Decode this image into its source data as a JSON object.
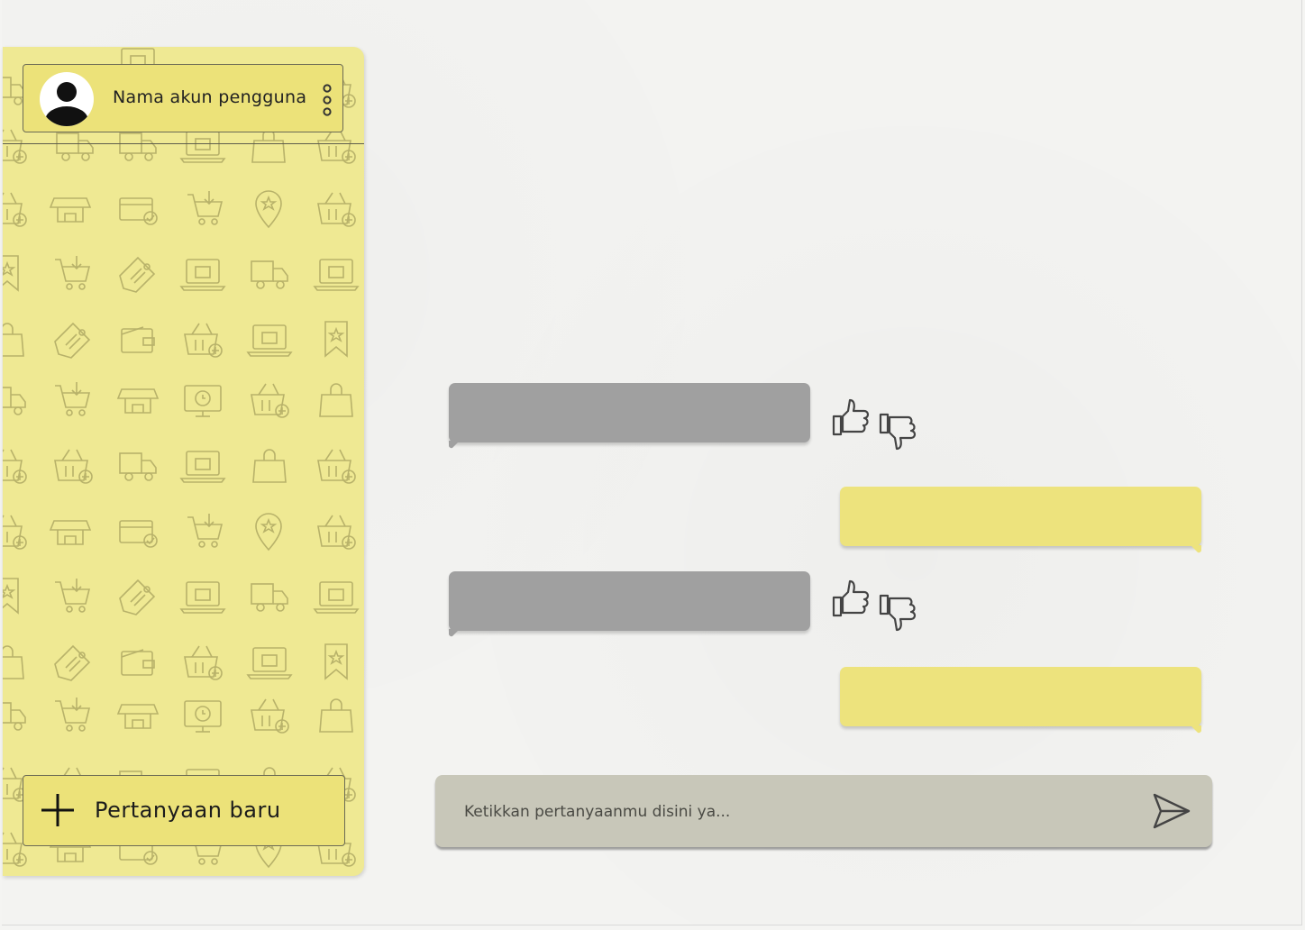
{
  "sidebar": {
    "account": {
      "name": "Nama akun pengguna",
      "avatar_icon": "user-avatar-icon",
      "menu_icon": "kebab-menu-icon"
    },
    "new_question": {
      "label": "Pertanyaan baru",
      "icon": "plus-icon"
    },
    "background_icons": [
      "store-icon",
      "credit-card-icon",
      "cart-download-icon",
      "location-pin-icon",
      "basket-add-icon",
      "cart-remove-icon",
      "price-tag-icon",
      "online-shop-icon",
      "delivery-truck-icon",
      "buy-laptop-icon",
      "coupon-icon",
      "wallet-icon",
      "basket-download-icon",
      "mobile-shop-icon",
      "bookmark-star-icon",
      "cart-add-icon",
      "24h-support-icon",
      "shopping-bag-icon"
    ]
  },
  "chat": {
    "messages": [
      {
        "role": "bot",
        "text": ""
      },
      {
        "role": "user",
        "text": ""
      },
      {
        "role": "bot",
        "text": ""
      },
      {
        "role": "user",
        "text": ""
      }
    ],
    "rating_icons": [
      "thumbs-up-icon",
      "thumbs-down-icon"
    ]
  },
  "composer": {
    "placeholder": "Ketikkan pertanyaanmu disini ya...",
    "value": "",
    "send_icon": "send-icon"
  },
  "colors": {
    "sidebar_bg": "#efe993",
    "card_bg": "#ece279",
    "bot_bubble": "#a0a0a0",
    "user_bubble": "#ede37d",
    "input_bg": "#c8c7b9"
  }
}
